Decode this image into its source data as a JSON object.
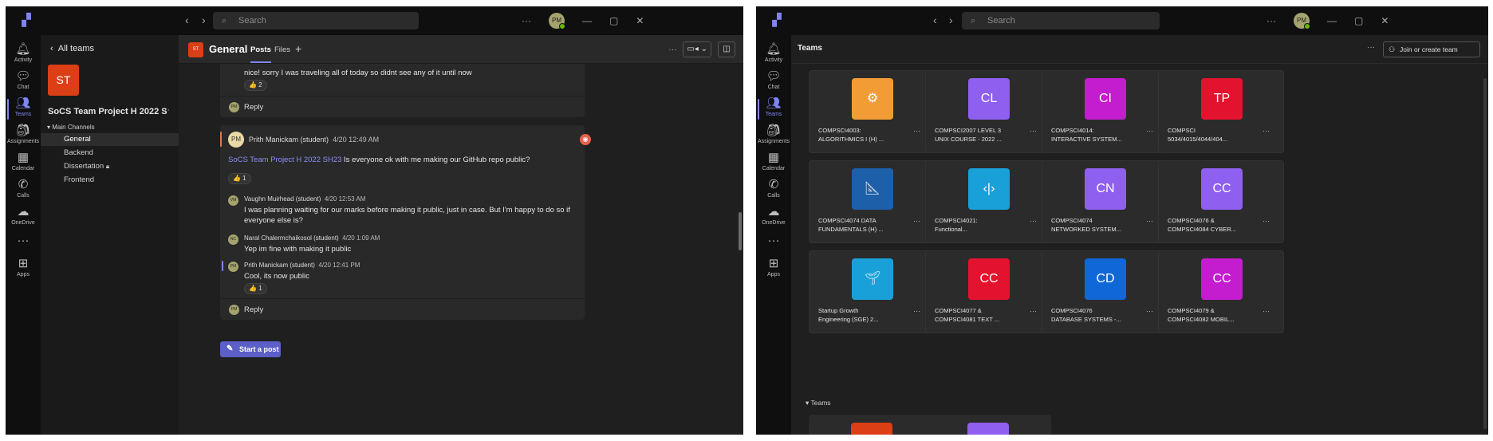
{
  "left": {
    "search_placeholder": "Search",
    "avatar_initials": "PM",
    "rail": [
      {
        "label": "Activity",
        "icon": "bell-icon",
        "glyph": "🔔︎"
      },
      {
        "label": "Chat",
        "icon": "chat-icon",
        "glyph": "💬︎"
      },
      {
        "label": "Teams",
        "icon": "teams-icon",
        "glyph": "👥︎"
      },
      {
        "label": "Assignments",
        "icon": "assignments-icon",
        "glyph": "🎒︎"
      },
      {
        "label": "Calendar",
        "icon": "calendar-icon",
        "glyph": "▦"
      },
      {
        "label": "Calls",
        "icon": "phone-icon",
        "glyph": "✆"
      },
      {
        "label": "OneDrive",
        "icon": "cloud-icon",
        "glyph": "☁"
      },
      {
        "label": "",
        "icon": "more-icon",
        "glyph": "···"
      },
      {
        "label": "Apps",
        "icon": "apps-icon",
        "glyph": "⊞"
      }
    ],
    "side": {
      "back_label": "All teams",
      "team_initials": "ST",
      "team_name": "SoCS Team Project H 2022 S...",
      "section": "Main Channels",
      "channels": [
        "General",
        "Backend",
        "Dissertation",
        "Frontend"
      ]
    },
    "header": {
      "badge": "ST",
      "title": "General",
      "tabs": [
        "Posts",
        "Files"
      ],
      "add": "+"
    },
    "thread1": {
      "text": "nice! sorry I was traveling all of today so didnt see any of it until now",
      "reaction": "👍 2",
      "reply": "Reply"
    },
    "thread2": {
      "author_initials": "PM",
      "author": "Prith Manickam (student)",
      "time": "4/20 12:49 AM",
      "mention": "SoCS Team Project H 2022 SH23",
      "text": " Is everyone ok with me making our GitHub repo public?",
      "reaction": "👍 1",
      "replies": [
        {
          "author": "Vaughn Muirhead (student)",
          "time": "4/20 12:53 AM",
          "text": "I was planning waiting for our marks before making it public, just in case. But I'm happy to do so if everyone else is?"
        },
        {
          "author": "Naral Chalermchaikosol (student)",
          "time": "4/20 1:09 AM",
          "text": "Yep im fine with making it public"
        },
        {
          "author": "Prith Manickam (student)",
          "time": "4/20 12:41 PM",
          "text": "Cool, its now public",
          "reaction": "👍 1"
        }
      ],
      "reply": "Reply"
    },
    "start_post": "Start a post"
  },
  "right": {
    "search_placeholder": "Search",
    "rail": [
      {
        "label": "Activity",
        "icon": "bell-icon",
        "glyph": "🔔︎"
      },
      {
        "label": "Chat",
        "icon": "chat-icon",
        "glyph": "💬︎"
      },
      {
        "label": "Teams",
        "icon": "teams-icon",
        "glyph": "👥︎"
      },
      {
        "label": "Assignments",
        "icon": "assignments-icon",
        "glyph": "🎒︎"
      },
      {
        "label": "Calendar",
        "icon": "calendar-icon",
        "glyph": "▦"
      },
      {
        "label": "Calls",
        "icon": "phone-icon",
        "glyph": "✆"
      },
      {
        "label": "OneDrive",
        "icon": "cloud-icon",
        "glyph": "☁"
      },
      {
        "label": "",
        "icon": "more-icon",
        "glyph": "···"
      },
      {
        "label": "Apps",
        "icon": "apps-icon",
        "glyph": "⊞"
      }
    ],
    "title": "Teams",
    "join_button": "Join or create team",
    "cards": [
      {
        "logo": "⚙",
        "color": "#f29c35",
        "name": "COMPSCI4003:\nALGORITHMICS I (H) ..."
      },
      {
        "logo": "CL",
        "color": "#8f5ff0",
        "name": "COMPSCI2007 LEVEL 3\nUNIX COURSE - 2022 ..."
      },
      {
        "logo": "CI",
        "color": "#c41ccf",
        "name": "COMPSCI4014:\nINTERACTIVE SYSTEM..."
      },
      {
        "logo": "TP",
        "color": "#e3122e",
        "name": "COMPSCI\n5034/4015/4044/404..."
      },
      {
        "logo": "📐︎",
        "color": "#1d5fa8",
        "name": "COMPSCI4074 DATA\nFUNDAMENTALS (H) ..."
      },
      {
        "logo": "‹|›",
        "color": "#1aa0d8",
        "name": "COMPSCI4021:\nFunctional..."
      },
      {
        "logo": "CN",
        "color": "#8f5ff0",
        "name": "COMPSCI4074\nNETWORKED SYSTEM..."
      },
      {
        "logo": "CC",
        "color": "#8f5ff0",
        "name": "COMPSCI4076 &\nCOMPSCI4084 CYBER..."
      },
      {
        "logo": "🌱︎",
        "color": "#1aa0d8",
        "name": "Startup Growth\nEngineering (SGE) 2..."
      },
      {
        "logo": "CC",
        "color": "#e3122e",
        "name": "COMPSCI4077 &\nCOMPSCI4081 TEXT ..."
      },
      {
        "logo": "CD",
        "color": "#1067d8",
        "name": "COMPSCI4076\nDATABASE SYSTEMS -..."
      },
      {
        "logo": "CC",
        "color": "#c41ccf",
        "name": "COMPSCI4079 &\nCOMPSCI4082 MOBIL..."
      }
    ],
    "section": "Teams"
  }
}
